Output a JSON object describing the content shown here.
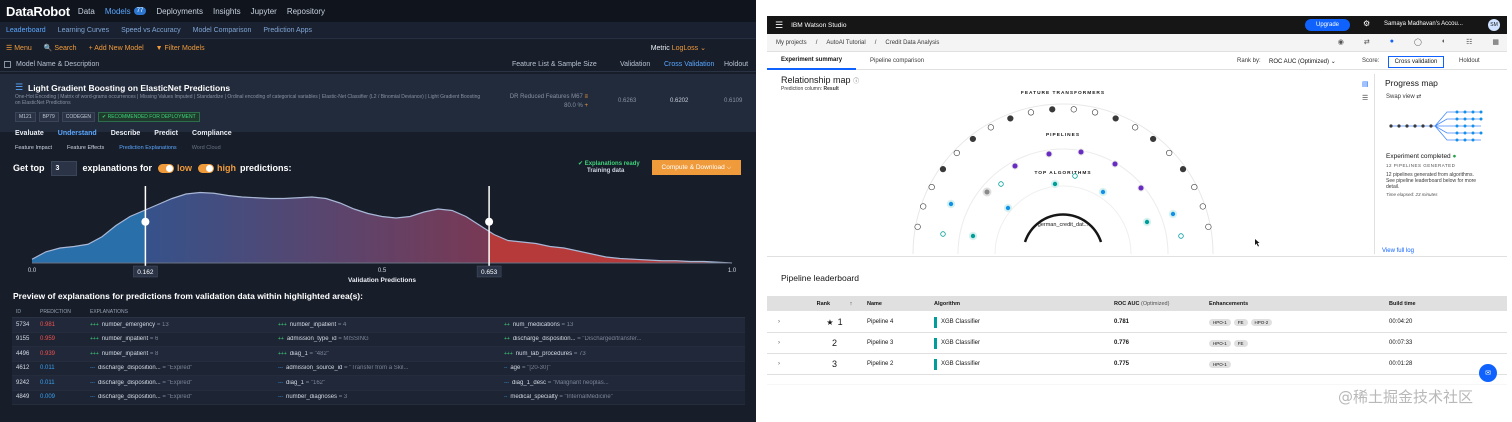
{
  "datarobot": {
    "logo": "DataRobot",
    "nav": [
      {
        "label": "Data"
      },
      {
        "label": "Models",
        "badge": "77",
        "active": true
      },
      {
        "label": "Deployments"
      },
      {
        "label": "Insights"
      },
      {
        "label": "Jupyter"
      },
      {
        "label": "Repository"
      }
    ],
    "subnav": [
      "Leaderboard",
      "Learning Curves",
      "Speed vs Accuracy",
      "Model Comparison",
      "Prediction Apps"
    ],
    "tools": [
      "☰ Menu",
      "🔍 Search",
      "+ Add New Model",
      "▼ Filter Models"
    ],
    "metric_label": "Metric",
    "metric_value": "LogLoss",
    "columns": {
      "name": "Model Name & Description",
      "feature": "Feature List & Sample Size",
      "validation": "Validation",
      "cv": "Cross Validation",
      "holdout": "Holdout"
    },
    "model": {
      "title": "Light Gradient Boosting on ElasticNet Predictions",
      "desc": "One-Hot Encoding | Matrix of word-grams occurrences | Missing Values Imputed | Standardize | Ordinal encoding of categorical variables | Elastic-Net Classifier (L2 / Binomial Deviance) | Light Gradient Boosting on ElasticNet Predictions",
      "tags": [
        "M121",
        "BP79",
        "CODEGEN"
      ],
      "recommended": "✔ RECOMMENDED FOR DEPLOYMENT",
      "feature_list": "DR Reduced Features M67",
      "sample": "80.0 %",
      "validation": "0.6263",
      "cv": "0.6202",
      "holdout": "0.6109"
    },
    "tabs": [
      "Evaluate",
      "Understand",
      "Describe",
      "Predict",
      "Compliance"
    ],
    "subtabs": [
      "Feature Impact",
      "Feature Effects",
      "Prediction Explanations",
      "Word Cloud"
    ],
    "gettop": {
      "prefix": "Get top",
      "count": "3",
      "middle": "explanations for",
      "low": "low",
      "high": "high",
      "suffix": "predictions:"
    },
    "ready": "✔ Explanations ready",
    "ready_sub": "Training data",
    "compute_button": "Compute & Download ⌵",
    "chart_xlabel": "Validation Predictions",
    "low_threshold": "0.162",
    "high_threshold": "0.653",
    "preview_title": "Preview of explanations for predictions from validation data within highlighted area(s):",
    "table_headers": {
      "id": "ID",
      "prediction": "PREDICTION",
      "explanations": "EXPLANATIONS"
    },
    "rows": [
      {
        "id": "5734",
        "pred": "0.981",
        "high": true,
        "e": [
          {
            "s": "+++",
            "f": "number_emergency",
            "v": "= 13"
          },
          {
            "s": "+++",
            "f": "number_inpatient",
            "v": "= 4"
          },
          {
            "s": "++",
            "f": "num_medications",
            "v": "= 13"
          }
        ]
      },
      {
        "id": "9155",
        "pred": "0.959",
        "high": true,
        "e": [
          {
            "s": "+++",
            "f": "number_inpatient",
            "v": "= 6"
          },
          {
            "s": "++",
            "f": "admission_type_id",
            "v": "= MISSING"
          },
          {
            "s": "++",
            "f": "discharge_disposition...",
            "v": "= \"Discharged/transfer..."
          }
        ]
      },
      {
        "id": "4496",
        "pred": "0.939",
        "high": true,
        "e": [
          {
            "s": "+++",
            "f": "number_inpatient",
            "v": "= 8"
          },
          {
            "s": "+++",
            "f": "diag_1",
            "v": "= \"482\""
          },
          {
            "s": "+++",
            "f": "num_lab_procedures",
            "v": "= 73"
          }
        ]
      },
      {
        "id": "4612",
        "pred": "0.011",
        "high": false,
        "e": [
          {
            "s": "---",
            "f": "discharge_disposition...",
            "v": "= \"Expired\""
          },
          {
            "s": "---",
            "f": "admission_source_id",
            "v": "= \"Transfer from a Skil..."
          },
          {
            "s": "--",
            "f": "age",
            "v": "= \"[20-30)\""
          }
        ]
      },
      {
        "id": "9242",
        "pred": "0.011",
        "high": false,
        "e": [
          {
            "s": "---",
            "f": "discharge_disposition...",
            "v": "= \"Expired\""
          },
          {
            "s": "---",
            "f": "diag_1",
            "v": "= \"162\""
          },
          {
            "s": "---",
            "f": "diag_1_desc",
            "v": "= \"Malignant neoplas..."
          }
        ]
      },
      {
        "id": "4849",
        "pred": "0.009",
        "high": false,
        "e": [
          {
            "s": "---",
            "f": "discharge_disposition...",
            "v": "= \"Expired\""
          },
          {
            "s": "---",
            "f": "number_diagnoses",
            "v": "= 3"
          },
          {
            "s": "--",
            "f": "medical_specialty",
            "v": "= \"InternalMedicine\""
          }
        ]
      }
    ]
  },
  "chart_data": {
    "type": "area",
    "xlabel": "Validation Predictions",
    "x_ticks": [
      "0.0",
      "0.5",
      "1.0"
    ],
    "xlim": [
      0,
      1
    ],
    "low_threshold": 0.162,
    "high_threshold": 0.653,
    "x": [
      0,
      0.02,
      0.04,
      0.06,
      0.08,
      0.1,
      0.12,
      0.14,
      0.16,
      0.18,
      0.2,
      0.22,
      0.24,
      0.26,
      0.28,
      0.3,
      0.32,
      0.34,
      0.36,
      0.38,
      0.4,
      0.42,
      0.44,
      0.46,
      0.48,
      0.5,
      0.52,
      0.54,
      0.56,
      0.58,
      0.6,
      0.62,
      0.64,
      0.66,
      0.68,
      0.7,
      0.72,
      0.74,
      0.76,
      0.78,
      0.8,
      0.82,
      0.84,
      0.86,
      0.88,
      0.9,
      0.92,
      0.94,
      0.96,
      0.98,
      1.0
    ],
    "density": [
      0.05,
      0.15,
      0.2,
      0.22,
      0.25,
      0.35,
      0.5,
      0.62,
      0.7,
      0.78,
      0.86,
      0.92,
      0.94,
      0.93,
      0.9,
      0.88,
      0.87,
      0.86,
      0.86,
      0.87,
      0.88,
      0.86,
      0.8,
      0.72,
      0.66,
      0.62,
      0.6,
      0.62,
      0.68,
      0.72,
      0.7,
      0.62,
      0.5,
      0.38,
      0.3,
      0.28,
      0.26,
      0.22,
      0.2,
      0.16,
      0.12,
      0.08,
      0.06,
      0.05,
      0.04,
      0.03,
      0.03,
      0.02,
      0.02,
      0.01,
      0.0
    ],
    "colors": {
      "low": "#2d7fc2",
      "mid": "#5a5a90",
      "high": "#d2403c"
    }
  },
  "watson": {
    "brand": "IBM Watson Studio",
    "upgrade": "Upgrade",
    "account": "Samaya Madhavan's Accou...",
    "avatar": "SM",
    "breadcrumb": [
      "My projects",
      "/",
      "AutoAI Tutorial",
      "/",
      "Credit Data Analysis"
    ],
    "tabs": [
      "Experiment summary",
      "Pipeline comparison"
    ],
    "rank_by_label": "Rank by:",
    "rank_by_value": "ROC AUC (Optimized)",
    "score_label": "Score:",
    "cv_button": "Cross validation",
    "holdout": "Holdout",
    "relmap_title": "Relationship map",
    "pred_col_label": "Prediction column:",
    "pred_col_value": "Result",
    "map_labels": {
      "ft": "FEATURE TRANSFORMERS",
      "pipes": "PIPELINES",
      "algos": "TOP ALGORITHMS",
      "center": "german_credit_dat..."
    },
    "progress_title": "Progress map",
    "swap_view": "Swap view ⇄",
    "exp_completed": "Experiment completed",
    "pipelines_gen": "12 PIPELINES GENERATED",
    "progress_desc": "12 pipelines generated from algorithms. See pipeline leaderboard below for more detail.",
    "time_elapsed": "Time elapsed: 23 minutes",
    "view_log": "View full log",
    "leaderboard_title": "Pipeline leaderboard",
    "table_headers": {
      "rank": "Rank",
      "name": "Name",
      "algorithm": "Algorithm",
      "roc": "ROC AUC",
      "roc_sub": "(Optimized)",
      "enh": "Enhancements",
      "build": "Build time"
    },
    "rows": [
      {
        "rank": "1",
        "star": true,
        "name": "Pipeline 4",
        "alg": "XGB Classifier",
        "roc": "0.781",
        "enh": [
          "HPO-1",
          "FE",
          "HPO-2"
        ],
        "bt": "00:04:20"
      },
      {
        "rank": "2",
        "star": false,
        "name": "Pipeline 3",
        "alg": "XGB Classifier",
        "roc": "0.776",
        "enh": [
          "HPO-1",
          "FE"
        ],
        "bt": "00:07:33"
      },
      {
        "rank": "3",
        "star": false,
        "name": "Pipeline 2",
        "alg": "XGB Classifier",
        "roc": "0.775",
        "enh": [
          "HPO-1"
        ],
        "bt": "00:01:28"
      }
    ]
  },
  "watermark": "@稀土掘金技术社区"
}
